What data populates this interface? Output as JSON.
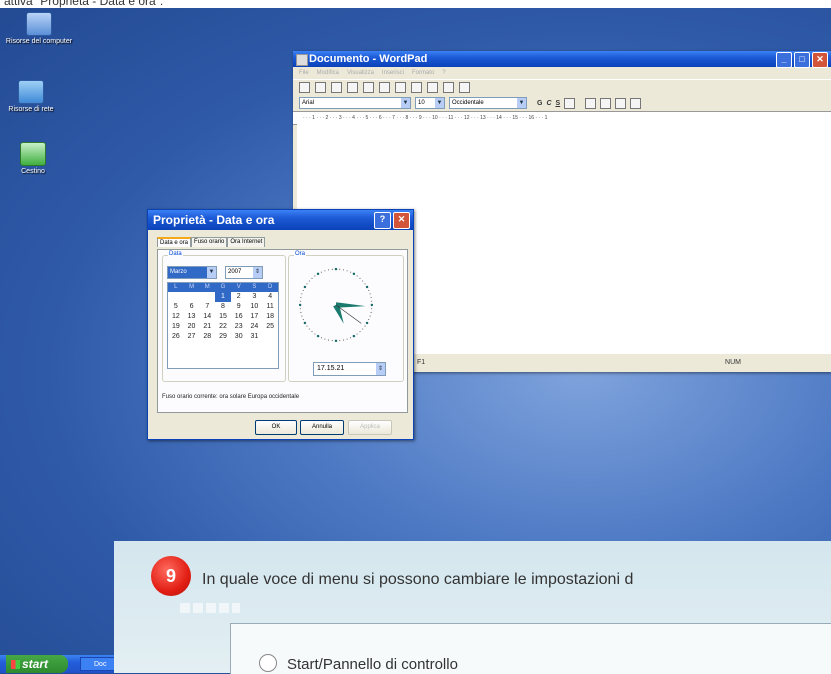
{
  "caption": "attiva \"Proprietà - Data e ora\".",
  "desktop_icons": [
    {
      "label": "Risorse del computer"
    },
    {
      "label": "Risorse di rete"
    },
    {
      "label": "Cestino"
    }
  ],
  "wordpad": {
    "title": "Documento - WordPad",
    "menu": [
      "File",
      "Modifica",
      "Visualizza",
      "Inserisci",
      "Formato",
      "?"
    ],
    "font": "Arial",
    "size": "10",
    "script": "Occidentale",
    "bold": "G",
    "italic": "C",
    "underline": "S",
    "ruler": "· · · 1 · · · 2 · · · 3 · · · 4 · · · 5 · · · 6 · · · 7 · · · 8 · · · 9 · · · 10 · · · 11 · · · 12 · · · 13 · · · 14 · · · 15 · · · 16 · · · 1",
    "status_help": "F1",
    "status_num": "NUM"
  },
  "dialog": {
    "title": "Proprietà - Data e ora",
    "tabs": [
      "Data e ora",
      "Fuso orario",
      "Ora Internet"
    ],
    "date_group": "Data",
    "time_group": "Ora",
    "month": "Marzo",
    "year": "2007",
    "weekdays": [
      "L",
      "M",
      "M",
      "G",
      "V",
      "S",
      "D"
    ],
    "days": [
      "",
      "",
      "",
      "1",
      "2",
      "3",
      "4",
      "5",
      "6",
      "7",
      "8",
      "9",
      "10",
      "11",
      "12",
      "13",
      "14",
      "15",
      "16",
      "17",
      "18",
      "19",
      "20",
      "21",
      "22",
      "23",
      "24",
      "25",
      "26",
      "27",
      "28",
      "29",
      "30",
      "31",
      "",
      "",
      ""
    ],
    "selected_day": "1",
    "time": "17.15.21",
    "clock": {
      "hour": 17,
      "minute": 15,
      "second": 21
    },
    "timezone": "Fuso orario corrente:  ora solare Europa occidentale",
    "ok": "OK",
    "cancel": "Annulla",
    "apply": "Applica"
  },
  "taskbar": {
    "start": "start",
    "task": "Doc"
  },
  "quiz": {
    "number": "9",
    "question": "In quale voce di menu si possono cambiare le impostazioni d",
    "answer1": "Start/Pannello di controllo"
  },
  "colors": {
    "xp_title": "#0a42b8",
    "xp_close": "#d2553a",
    "badge": "#e21e14",
    "start_green": "#2e8b2e"
  }
}
